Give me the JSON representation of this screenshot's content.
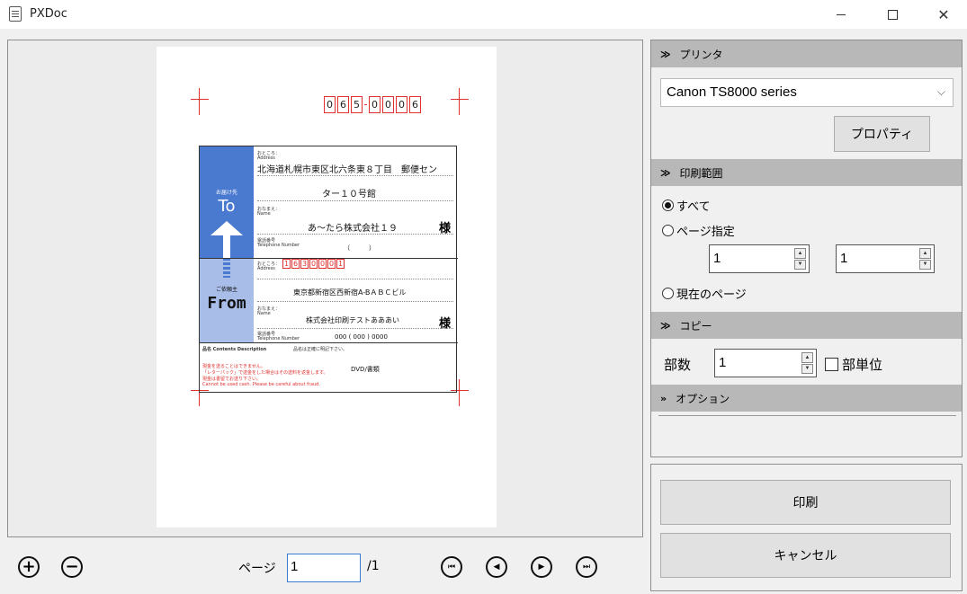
{
  "window": {
    "title": "PXDoc",
    "minimize_icon": "minimize-icon",
    "maximize_icon": "maximize-icon",
    "close_glyph": "✕"
  },
  "preview": {
    "postal_digits": [
      "0",
      "6",
      "5",
      "0",
      "0",
      "0",
      "6"
    ],
    "to": {
      "band_small": "お届け先",
      "band_word": "To",
      "address_label": "おところ：",
      "address_label_en": "Address",
      "address_line1": "北海道札幌市東区北六条東８丁目　郵便セン",
      "address_line2": "ター１０号館",
      "name_label": "おなまえ：",
      "name_label_en": "Name",
      "name": "あ〜たら株式会社１９",
      "honorific": "様",
      "tel_label": "電話番号",
      "tel_label_en": "Telephone Number",
      "tel_value": "（　　　）"
    },
    "from": {
      "band_small": "ご依頼主",
      "band_word": "From",
      "address_label": "おところ：",
      "address_label_en": "Address",
      "postal_digits": [
        "1",
        "6",
        "3",
        "0",
        "0",
        "0",
        "1"
      ],
      "address_line": "東京都新宿区西新宿A-BＡＢＣビル",
      "name_label": "おなまえ：",
      "name_label_en": "Name",
      "name": "株式会社印刷テストあああい",
      "honorific": "様",
      "tel_label": "電話番号",
      "tel_label_en": "Telephone Number",
      "tel_value": "000 ( 000 ) 0000"
    },
    "contents": {
      "label": "品名 Contents Description",
      "note_line1": "品名は正確に明記下さい。",
      "value": "DVD/書類",
      "warning1": "現金を送ることはできません。",
      "warning2": "「レターパック」で送金をした場合はその送料を返金します。",
      "warning3": "現金は書留でお送り下さい。",
      "warning4": "Cannot be used cash. Please be careful about fraud."
    }
  },
  "toolbar": {
    "zoom_in_glyph": "+",
    "zoom_out_glyph": "−",
    "page_label": "ページ",
    "page_value": "1",
    "page_total": "/1",
    "first_glyph": "⏮",
    "prev_glyph": "◀",
    "next_glyph": "▶",
    "last_glyph": "⏭"
  },
  "panel": {
    "printer": {
      "header": "プリンタ",
      "selected": "Canon TS8000 series",
      "properties_button": "プロパティ"
    },
    "range": {
      "header": "印刷範囲",
      "all": "すべて",
      "pages": "ページ指定",
      "from_value": "1",
      "to_value": "1",
      "current": "現在のページ",
      "selected": "all"
    },
    "copy": {
      "header": "コピー",
      "copies_label": "部数",
      "copies_value": "1",
      "collate_label": "部単位",
      "collate_checked": false
    },
    "options": {
      "header": "オプション"
    },
    "expanded_chevron": "≫",
    "collapsed_chevron": "»"
  },
  "actions": {
    "print_button": "印刷",
    "cancel_button": "キャンセル"
  },
  "colors": {
    "accent_red": "#e03030",
    "to_band": "#4a7ad0",
    "from_band": "#a8bde8",
    "section_header": "#b8b8b8",
    "input_focus": "#3c7ccf"
  }
}
